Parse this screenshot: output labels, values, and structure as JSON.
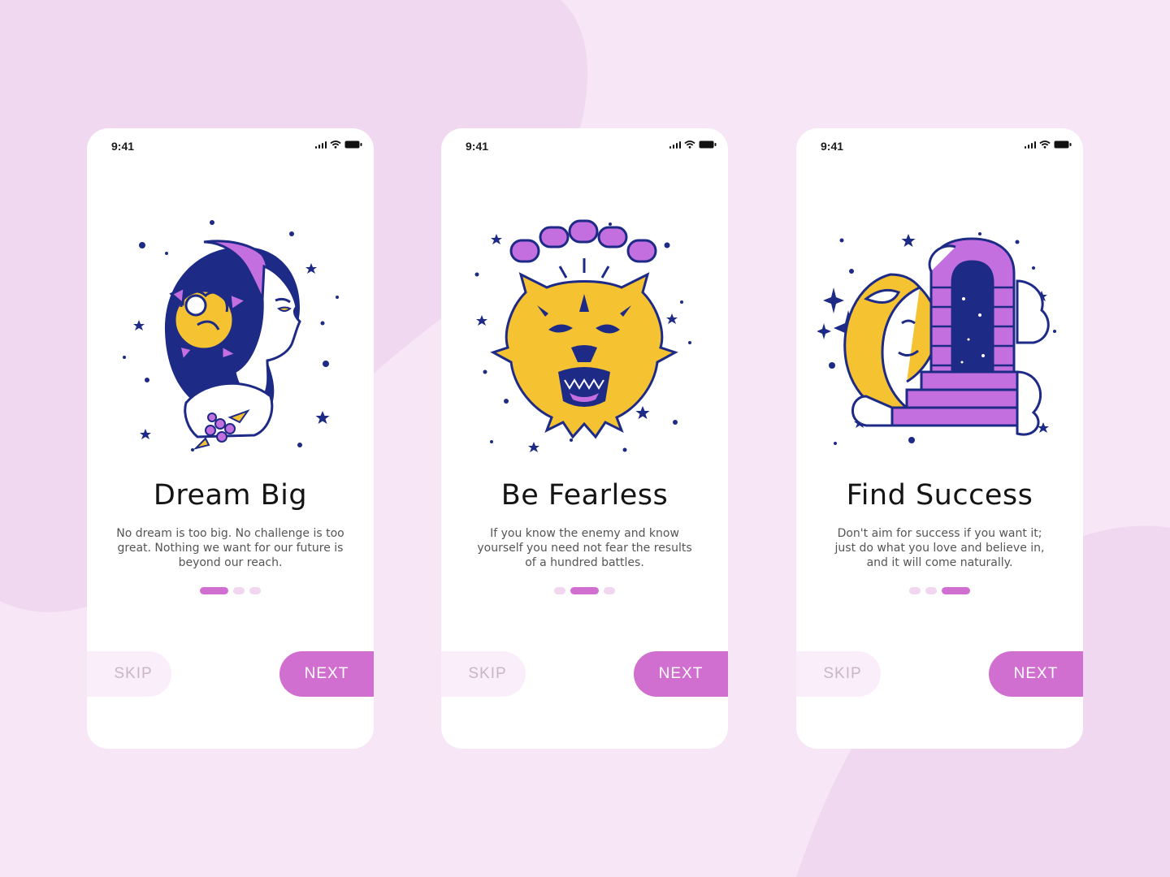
{
  "colors": {
    "background": "#f6e6f6",
    "background_blob": "#f0d6f0",
    "accent": "#d06fd0",
    "accent_light": "#fbeefb",
    "navy": "#1d2a86",
    "yellow": "#f5c231",
    "violet": "#c46fe0"
  },
  "screens": [
    {
      "status_time": "9:41",
      "illustration_icon": "woman-with-rose-icon",
      "title": "Dream Big",
      "description": "No dream is too big. No challenge is too great. Nothing we want for our future is beyond our reach.",
      "active_page": 1,
      "page_count": 3,
      "skip_label": "SKIP",
      "next_label": "NEXT"
    },
    {
      "status_time": "9:41",
      "illustration_icon": "tiger-with-chain-icon",
      "title": "Be Fearless",
      "description": "If you know the enemy and know yourself you need not fear the results of a hundred battles.",
      "active_page": 2,
      "page_count": 3,
      "skip_label": "SKIP",
      "next_label": "NEXT"
    },
    {
      "status_time": "9:41",
      "illustration_icon": "moon-and-door-icon",
      "title": "Find Success",
      "description": "Don't aim for success if you want it; just do what you love and believe in, and it will come naturally.",
      "active_page": 3,
      "page_count": 3,
      "skip_label": "SKIP",
      "next_label": "NEXT"
    }
  ]
}
